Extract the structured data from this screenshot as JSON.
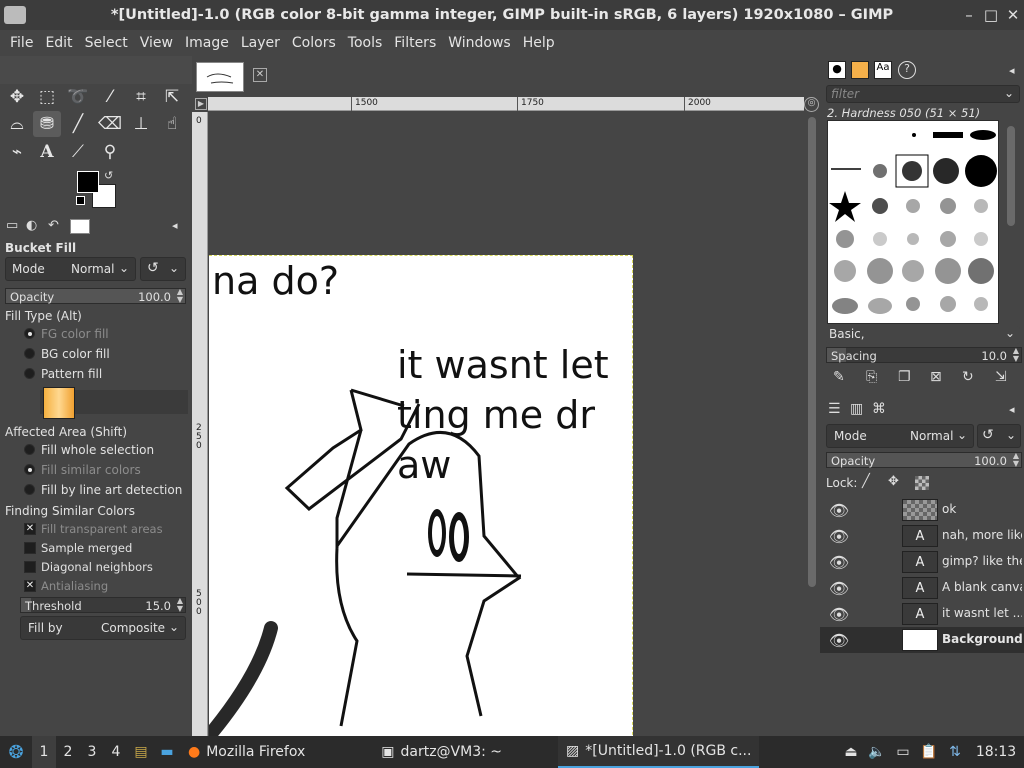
{
  "window": {
    "title": "*[Untitled]-1.0 (RGB color 8-bit gamma integer, GIMP built-in sRGB, 6 layers) 1920x1080 – GIMP",
    "minimize": "–",
    "maximize": "□",
    "close": "✕"
  },
  "menu": [
    "File",
    "Edit",
    "Select",
    "View",
    "Image",
    "Layer",
    "Colors",
    "Tools",
    "Filters",
    "Windows",
    "Help"
  ],
  "tool_options": {
    "title": "Bucket Fill",
    "mode_label": "Mode",
    "mode_value": "Normal",
    "opacity_label": "Opacity",
    "opacity_value": "100.0",
    "opacity_fraction": 1.0,
    "fill_type_label": "Fill Type  (Alt)",
    "fill_types": [
      "FG color fill",
      "BG color fill",
      "Pattern fill"
    ],
    "affected_area_label": "Affected Area  (Shift)",
    "affected_areas": [
      "Fill whole selection",
      "Fill similar colors",
      "Fill by line art detection"
    ],
    "finding_label": "Finding Similar Colors",
    "checks": [
      {
        "label": "Fill transparent areas",
        "checked": true,
        "dim": true
      },
      {
        "label": "Sample merged",
        "checked": false,
        "dim": false
      },
      {
        "label": "Diagonal neighbors",
        "checked": false,
        "dim": false
      },
      {
        "label": "Antialiasing",
        "checked": true,
        "dim": true
      }
    ],
    "threshold_label": "Threshold",
    "threshold_value": "15.0",
    "threshold_fraction": 0.06,
    "fillby_label": "Fill by",
    "fillby_value": "Composite"
  },
  "canvas": {
    "ruler_marks": [
      "1500",
      "1750",
      "2000"
    ],
    "vruler_marks": [
      "0",
      "250",
      "500"
    ],
    "texts": {
      "t1": "na do?",
      "t2": "it wasnt let",
      "t3": "ting me dr",
      "t4": "aw"
    }
  },
  "brushes": {
    "filter_placeholder": "filter",
    "current": "2. Hardness 050 (51 × 51)",
    "preset": "Basic,",
    "spacing_label": "Spacing",
    "spacing_value": "10.0",
    "spacing_fraction": 0.1
  },
  "layers": {
    "mode_label": "Mode",
    "mode_value": "Normal",
    "opacity_label": "Opacity",
    "opacity_value": "100.0",
    "opacity_fraction": 1.0,
    "lock_label": "Lock:",
    "items": [
      {
        "name": "ok",
        "type": "transparent"
      },
      {
        "name": "nah, more like",
        "type": "text"
      },
      {
        "name": "gimp? like the",
        "type": "text"
      },
      {
        "name": "A blank canva",
        "type": "text"
      },
      {
        "name": "it wasnt let ...",
        "type": "text"
      },
      {
        "name": "Background",
        "type": "image"
      }
    ]
  },
  "taskbar": {
    "workspaces": [
      "1",
      "2",
      "3",
      "4"
    ],
    "tasks": [
      "Mozilla Firefox",
      "dartz@VM3: ~",
      "*[Untitled]-1.0 (RGB c..."
    ],
    "clock": "18:13"
  }
}
